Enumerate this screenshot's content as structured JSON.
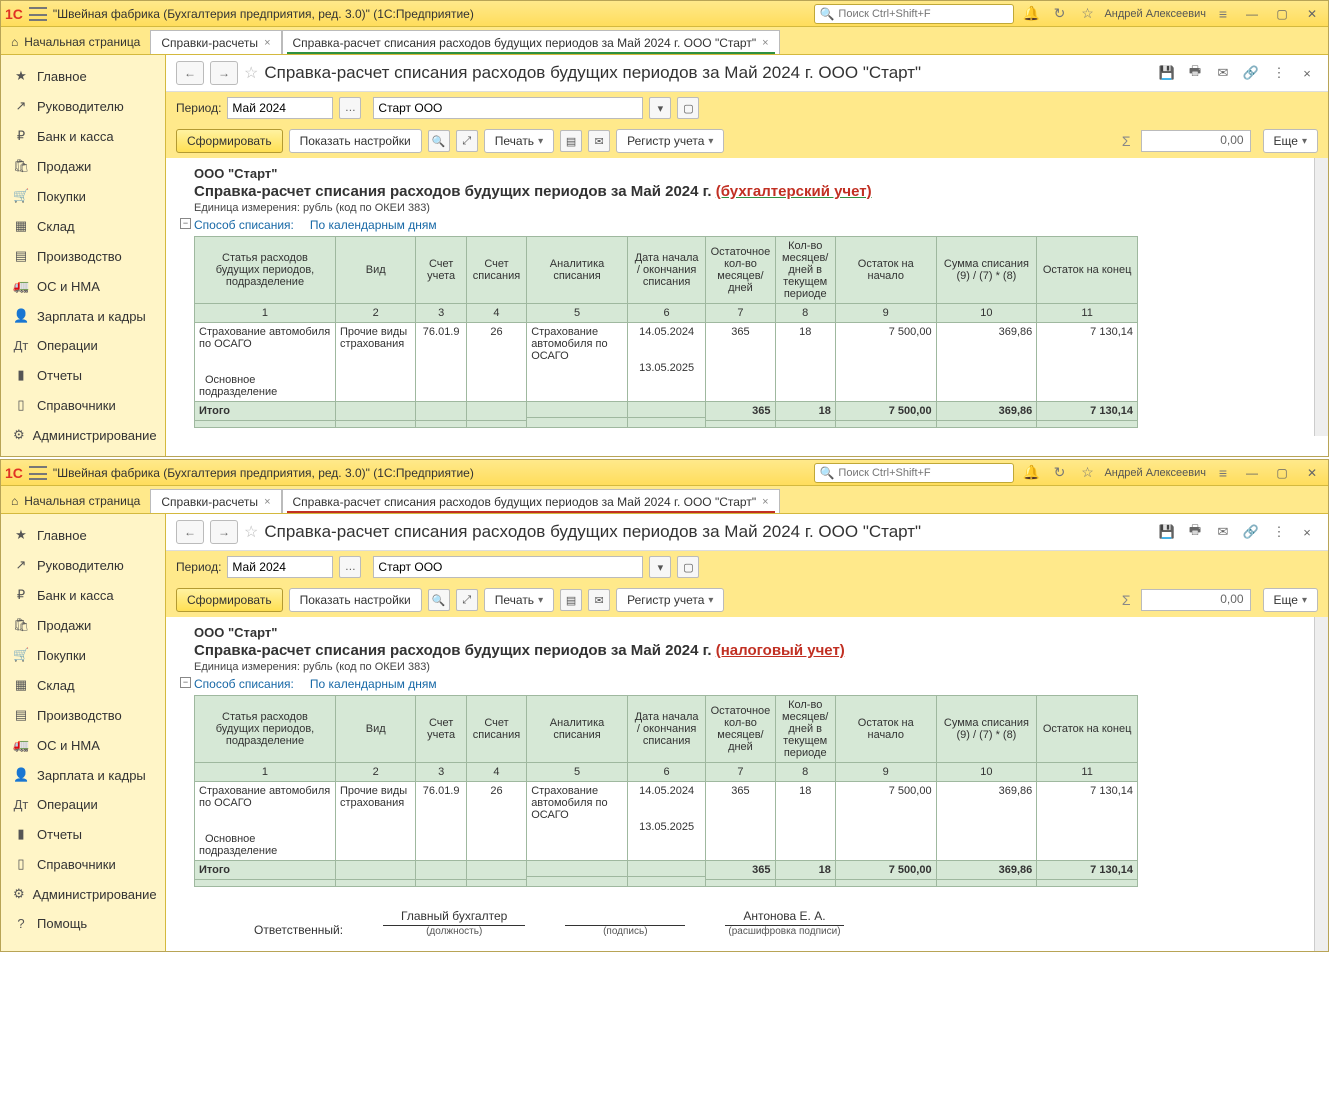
{
  "app": {
    "title": "\"Швейная фабрика (Бухгалтерия предприятия, ред. 3.0)\"  (1С:Предприятие)",
    "search_placeholder": "Поиск Ctrl+Shift+F",
    "user": "Андрей Алексеевич"
  },
  "tabs": {
    "home": "Начальная страница",
    "t1": "Справки-расчеты",
    "t2": "Справка-расчет списания расходов будущих периодов за Май 2024 г. ООО \"Старт\""
  },
  "sidebar": [
    {
      "icon": "★",
      "label": "Главное"
    },
    {
      "icon": "↗",
      "label": "Руководителю"
    },
    {
      "icon": "₽",
      "label": "Банк и касса"
    },
    {
      "icon": "🛍",
      "label": "Продажи"
    },
    {
      "icon": "🛒",
      "label": "Покупки"
    },
    {
      "icon": "▦",
      "label": "Склад"
    },
    {
      "icon": "▤",
      "label": "Производство"
    },
    {
      "icon": "🚛",
      "label": "ОС и НМА"
    },
    {
      "icon": "👤",
      "label": "Зарплата и кадры"
    },
    {
      "icon": "Дт",
      "label": "Операции"
    },
    {
      "icon": "▮",
      "label": "Отчеты"
    },
    {
      "icon": "▯",
      "label": "Справочники"
    },
    {
      "icon": "⚙",
      "label": "Администрирование"
    }
  ],
  "sidebar_extra": {
    "icon": "?",
    "label": "Помощь"
  },
  "doc": {
    "title": "Справка-расчет списания расходов будущих периодов за Май 2024 г. ООО \"Старт\"",
    "period_label": "Период:",
    "period_value": "Май 2024",
    "org_value": "Старт ООО",
    "form_btn": "Сформировать",
    "settings_btn": "Показать настройки",
    "print_btn": "Печать",
    "register_btn": "Регистр учета",
    "sum_value": "0,00",
    "more_btn": "Еще"
  },
  "report": {
    "org": "ООО \"Старт\"",
    "title_main": "Справка-расчет списания расходов будущих периодов за Май 2024 г. ",
    "title_bu": "(бухгалтерский учет)",
    "title_nu": "(налоговый учет)",
    "unit": "Единица измерения: рубль (код по ОКЕИ 383)",
    "method_l": "Способ списания:",
    "method_v": "По календарным дням",
    "headers": {
      "c1": "Статья расходов будущих периодов, подразделение",
      "c2": "Вид",
      "c3": "Счет учета",
      "c4": "Счет списания",
      "c5": "Аналитика списания",
      "c6": "Дата начала / окончания списания",
      "c7": "Остаточное кол-во месяцев/дней",
      "c8": "Кол-во месяцев/дней в текущем периоде",
      "c9": "Остаток на начало",
      "c10": "Сумма списания (9) / (7) * (8)",
      "c11": "Остаток на конец"
    },
    "nums": {
      "n1": "1",
      "n2": "2",
      "n3": "3",
      "n4": "4",
      "n5": "5",
      "n6": "6",
      "n7": "7",
      "n8": "8",
      "n9": "9",
      "n10": "10",
      "n11": "11"
    },
    "row": {
      "c1a": "Страхование автомобиля по ОСАГО",
      "c1b": "Основное подразделение",
      "c2": "Прочие виды страхования",
      "c3": "76.01.9",
      "c4": "26",
      "c5": "Страхование автомобиля по ОСАГО",
      "c6a": "14.05.2024",
      "c6b": "13.05.2025",
      "c7": "365",
      "c8": "18",
      "c9": "7 500,00",
      "c10": "369,86",
      "c11": "7 130,14"
    },
    "total_label": "Итого",
    "total": {
      "c7": "365",
      "c8": "18",
      "c9": "7 500,00",
      "c10": "369,86",
      "c11": "7 130,14"
    }
  },
  "signatures": {
    "resp": "Ответственный:",
    "pos_v": "Главный бухгалтер",
    "pos_c": "(должность)",
    "sign_c": "(подпись)",
    "name_v": "Антонова Е. А.",
    "name_c": "(расшифровка подписи)"
  }
}
